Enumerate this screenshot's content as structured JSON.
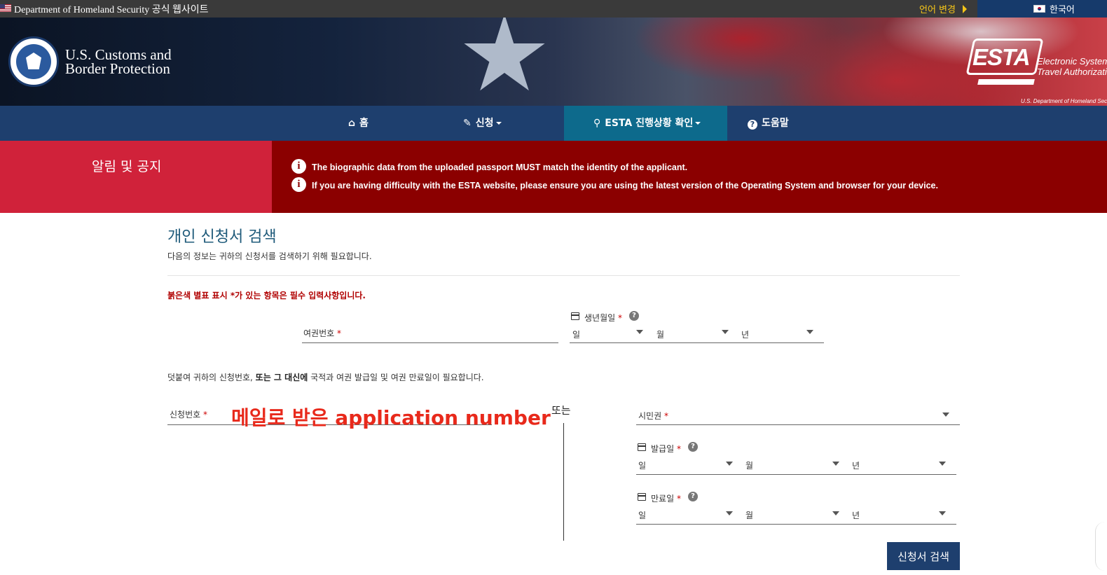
{
  "gov_bar": {
    "official_text": "Department of Homeland Security 공식 웹사이트",
    "change_language": "언어 변경",
    "current_language": "한국어"
  },
  "header": {
    "agency_line1": "U.S. Customs and",
    "agency_line2": "Border Protection",
    "esta_logo": "ESTA",
    "esta_sub_line1": "Electronic System for",
    "esta_sub_line2": "Travel Authorization",
    "esta_dept": "U.S. Department of Homeland Security"
  },
  "nav": {
    "home": "홈",
    "apply": "신청",
    "status": "ESTA 진행상황 확인",
    "help": "도움말"
  },
  "notices": {
    "title": "알림 및 공지",
    "items": [
      "The biographic data from the uploaded passport MUST match the identity of the applicant.",
      "If you are having difficulty with the ESTA website, please ensure you are using the latest version of the Operating System and browser for your device."
    ]
  },
  "main": {
    "title": "개인 신청서 검색",
    "subtitle": "다음의 정보는 귀하의 신청서를 검색하기 위해 필요합니다.",
    "required_note": "붉은색 별표 표시 *가 있는 항목은 필수 입력사항입니다.",
    "passport_label": "여권번호",
    "required_mark": "*",
    "dob_label": "생년월일",
    "day": "일",
    "month": "월",
    "year": "년",
    "also_prefix": "덧붙여 귀하의 신청번호, ",
    "also_bold": "또는 그 대신에",
    "also_suffix": " 국적과 여권 발급일 및 여권 만료일이 필요합니다.",
    "app_number_label": "신청번호",
    "annotation": "메일로 받은 application number",
    "or": "또는",
    "citizenship_label": "시민권",
    "issue_label": "발급일",
    "expiry_label": "만료일",
    "search_button": "신청서 검색"
  },
  "colors": {
    "nav_bg": "#1e3f6e",
    "nav_active": "#0d6a8c",
    "notice_left": "#d0223a",
    "notice_right": "#8b0000",
    "title_color": "#1e5a7a",
    "annotation_red": "#e8291b"
  }
}
